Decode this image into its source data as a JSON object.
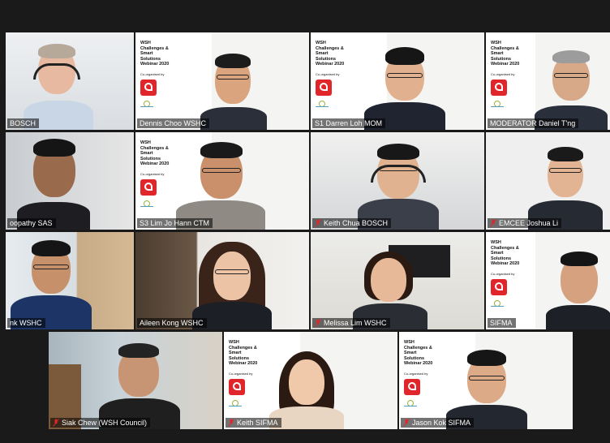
{
  "poster": {
    "lines": [
      "WSH",
      "Challenges &",
      "Smart",
      "Solutions",
      "Webinar 2020"
    ],
    "organised_by": "Co-organised by",
    "logo_text": "SIFMA"
  },
  "participants": [
    {
      "name": "BOSCH",
      "muted": false
    },
    {
      "name": "Dennis Choo WSHC",
      "muted": false
    },
    {
      "name": "S1 Darren Loh MOM",
      "muted": false
    },
    {
      "name": "MODERATOR Daniel T'ng",
      "muted": false
    },
    {
      "name": "oopathy SAS",
      "muted": false
    },
    {
      "name": "S3 Lim Jo Hann CTM",
      "muted": false
    },
    {
      "name": "Keith Chua BOSCH",
      "muted": true
    },
    {
      "name": "EMCEE Joshua Li",
      "muted": true
    },
    {
      "name": "nk WSHC",
      "muted": false
    },
    {
      "name": "Aileen Kong WSHC",
      "muted": false
    },
    {
      "name": "Melissa Lim WSHC",
      "muted": true
    },
    {
      "name": "SIFMA",
      "muted": false
    },
    {
      "name": "Siak Chew (WSH Council)",
      "muted": true
    },
    {
      "name": "Keith SIFMA",
      "muted": true
    },
    {
      "name": "Jason Kok SIFMA",
      "muted": true
    }
  ],
  "colors": {
    "active_speaker": "#d9e37a",
    "mute_icon": "#e0262a"
  }
}
